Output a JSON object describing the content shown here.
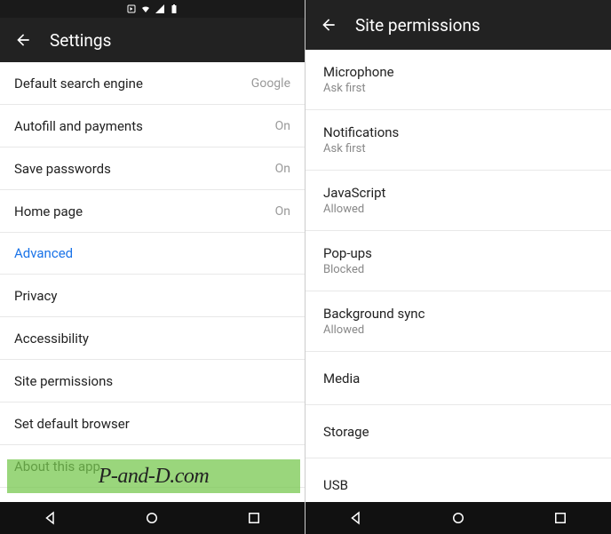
{
  "left": {
    "title": "Settings",
    "items": [
      {
        "label": "Default search engine",
        "value": "Google"
      },
      {
        "label": "Autofill and payments",
        "value": "On"
      },
      {
        "label": "Save passwords",
        "value": "On"
      },
      {
        "label": "Home page",
        "value": "On"
      }
    ],
    "section": "Advanced",
    "advanced": [
      {
        "label": "Privacy"
      },
      {
        "label": "Accessibility"
      },
      {
        "label": "Site permissions"
      },
      {
        "label": "Set default browser"
      },
      {
        "label": "About this app"
      }
    ]
  },
  "right": {
    "title": "Site permissions",
    "items": [
      {
        "label": "Microphone",
        "sub": "Ask first"
      },
      {
        "label": "Notifications",
        "sub": "Ask first"
      },
      {
        "label": "JavaScript",
        "sub": "Allowed"
      },
      {
        "label": "Pop-ups",
        "sub": "Blocked"
      },
      {
        "label": "Background sync",
        "sub": "Allowed"
      },
      {
        "label": "Media",
        "sub": ""
      },
      {
        "label": "Storage",
        "sub": ""
      },
      {
        "label": "USB",
        "sub": ""
      }
    ]
  },
  "watermark": "P-and-D.com"
}
